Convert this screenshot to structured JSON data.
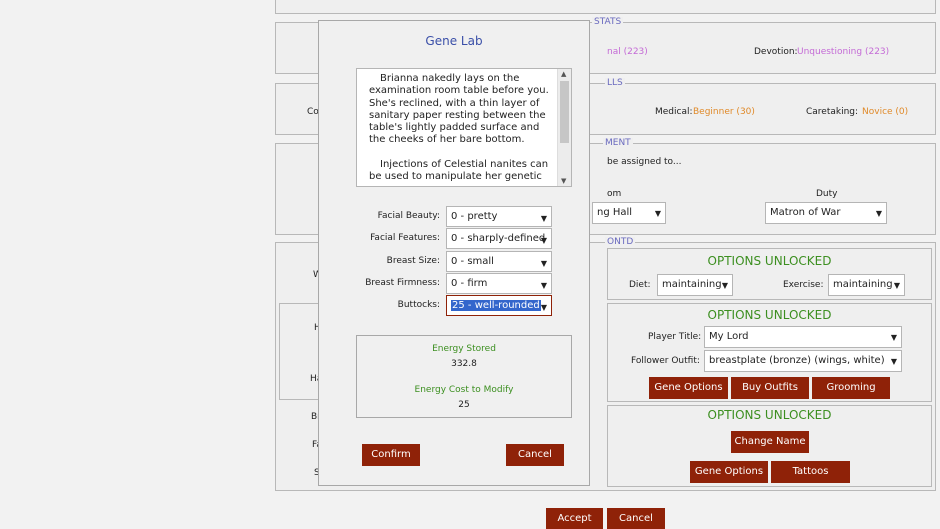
{
  "background": {
    "stats": {
      "legend": "STATS",
      "partial_value": "nal (223)",
      "devotion_label": "Devotion:",
      "devotion_value": "Unquestioning (223)"
    },
    "skills": {
      "legend": "LLS",
      "left_partial": "Co",
      "medical_label": "Medical:",
      "medical_value": "Beginner (30)",
      "caretaking_label": "Caretaking:",
      "caretaking_value": "Novice (0)"
    },
    "assignment": {
      "legend": "MENT",
      "text": "be assigned to...",
      "room_header": "om",
      "room_value": "ng Hall",
      "duty_header": "Duty",
      "duty_value": "Matron of War"
    },
    "contd": {
      "legend": "ONTD",
      "left_partials": [
        "W",
        "H",
        "Ha",
        "Br",
        "Fa",
        "S"
      ]
    },
    "panel1": {
      "title": "OPTIONS UNLOCKED",
      "diet_label": "Diet:",
      "diet_value": "maintaining",
      "exercise_label": "Exercise:",
      "exercise_value": "maintaining"
    },
    "panel2": {
      "title": "OPTIONS UNLOCKED",
      "player_title_label": "Player Title:",
      "player_title_value": "My Lord",
      "outfit_label": "Follower Outfit:",
      "outfit_value": "breastplate (bronze) (wings, white)",
      "buttons": [
        "Gene Options",
        "Buy Outfits",
        "Grooming"
      ]
    },
    "panel3": {
      "title": "OPTIONS UNLOCKED",
      "change_name": "Change Name",
      "gene_options": "Gene Options",
      "tattoos": "Tattoos"
    },
    "accept": "Accept",
    "cancel": "Cancel"
  },
  "dialog": {
    "title": "Gene Lab",
    "description_p1": "Brianna nakedly lays on the examination room table before you. She's reclined, with a thin layer of sanitary paper resting between the table's lightly padded surface and the cheeks of her bare bottom.",
    "description_p2": "Injections of Celestial nanites can be used to manipulate her genetic",
    "fields": [
      {
        "label": "Facial Beauty:",
        "value": "0 - pretty"
      },
      {
        "label": "Facial Features:",
        "value": "0 - sharply-defined"
      },
      {
        "label": "Breast Size:",
        "value": "0 - small"
      },
      {
        "label": "Breast Firmness:",
        "value": "0 - firm"
      },
      {
        "label": "Buttocks:",
        "value": "25 - well-rounded"
      }
    ],
    "energy_stored_label": "Energy Stored",
    "energy_stored_value": "332.8",
    "energy_cost_label": "Energy Cost to Modify",
    "energy_cost_value": "25",
    "confirm": "Confirm",
    "cancel": "Cancel"
  }
}
